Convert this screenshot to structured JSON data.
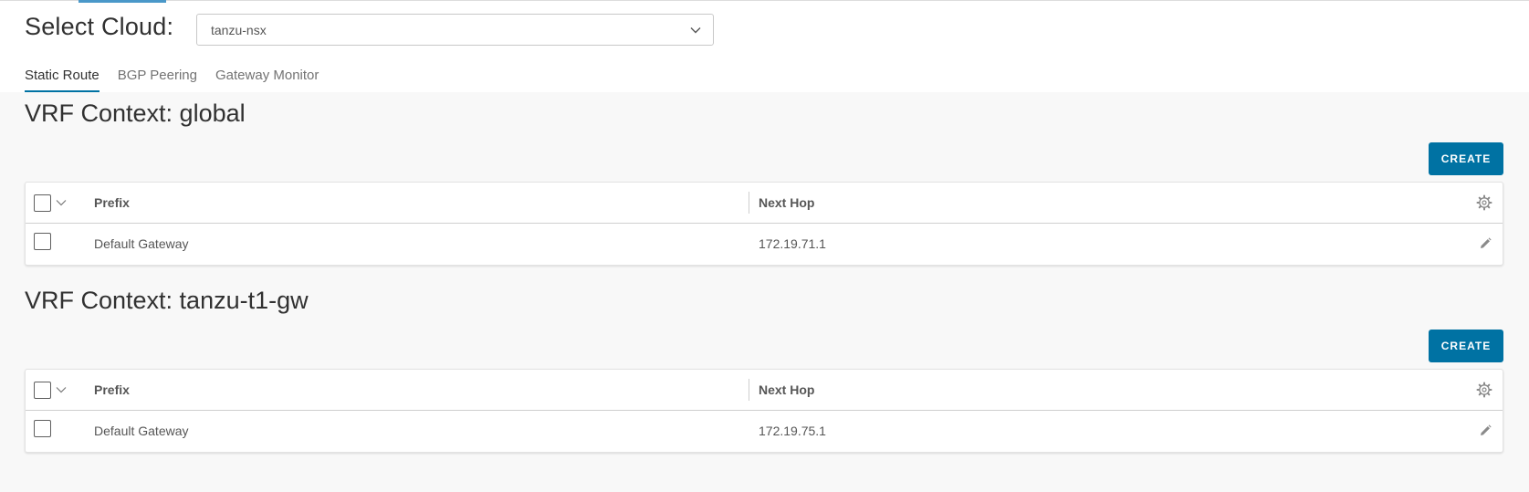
{
  "header": {
    "cloud_label": "Select Cloud:",
    "cloud_value": "tanzu-nsx",
    "tabs": [
      {
        "label": "Static Route",
        "active": true
      },
      {
        "label": "BGP Peering",
        "active": false
      },
      {
        "label": "Gateway Monitor",
        "active": false
      }
    ]
  },
  "vrf_sections": [
    {
      "title": "VRF Context: global",
      "create_label": "CREATE",
      "columns": {
        "prefix": "Prefix",
        "next_hop": "Next Hop"
      },
      "rows": [
        {
          "prefix": "Default Gateway",
          "next_hop": "172.19.71.1"
        }
      ]
    },
    {
      "title": "VRF Context: tanzu-t1-gw",
      "create_label": "CREATE",
      "columns": {
        "prefix": "Prefix",
        "next_hop": "Next Hop"
      },
      "rows": [
        {
          "prefix": "Default Gateway",
          "next_hop": "172.19.75.1"
        }
      ]
    }
  ],
  "colors": {
    "primary": "#0072a3",
    "background": "#f8f8f8",
    "text": "#313131"
  },
  "icons": [
    "chevron-down-icon",
    "gear-icon",
    "pencil-icon"
  ]
}
